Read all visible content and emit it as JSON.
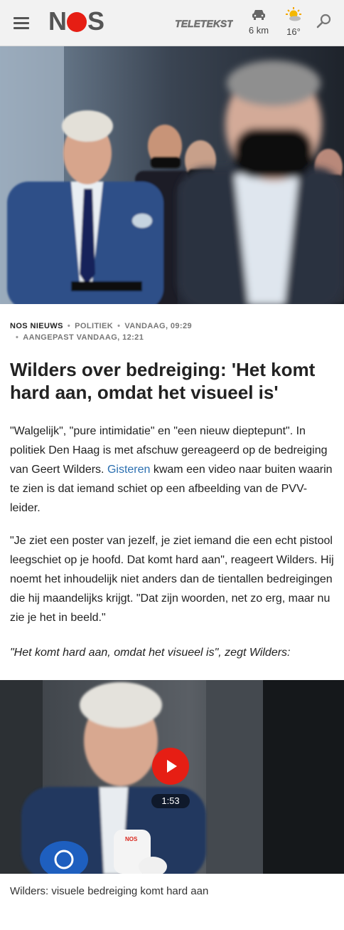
{
  "header": {
    "logo_text": "NOS",
    "teletekst_label": "TELETEKST",
    "traffic_value": "6 km",
    "weather_value": "16°"
  },
  "meta": {
    "source": "NOS NIEUWS",
    "category": "POLITIEK",
    "published": "VANDAAG, 09:29",
    "updated": "AANGEPAST VANDAAG, 12:21"
  },
  "article": {
    "title": "Wilders over bedreiging: 'Het komt hard aan, omdat het visueel is'",
    "p1_a": "\"Walgelijk\", \"pure intimidatie\" en \"een nieuw dieptepunt\". In politiek Den Haag is met afschuw gereageerd op de bedreiging van Geert Wilders. ",
    "p1_link": "Gisteren",
    "p1_b": " kwam een video naar buiten waarin te zien is dat iemand schiet op een afbeelding van de PVV-leider.",
    "p2": "\"Je ziet een poster van jezelf, je ziet iemand die een echt pistool leegschiet op je hoofd. Dat komt hard aan\", reageert Wilders. Hij noemt het inhoudelijk niet anders dan de tientallen bedreigingen die hij maandelijks krijgt. \"Dat zijn woorden, net zo erg, maar nu zie je het in beeld.\"",
    "p3": "\"Het komt hard aan, omdat het visueel is\", zegt Wilders:"
  },
  "video": {
    "duration": "1:53",
    "caption": "Wilders: visuele bedreiging komt hard aan",
    "mic_logo_text": "NOS"
  }
}
